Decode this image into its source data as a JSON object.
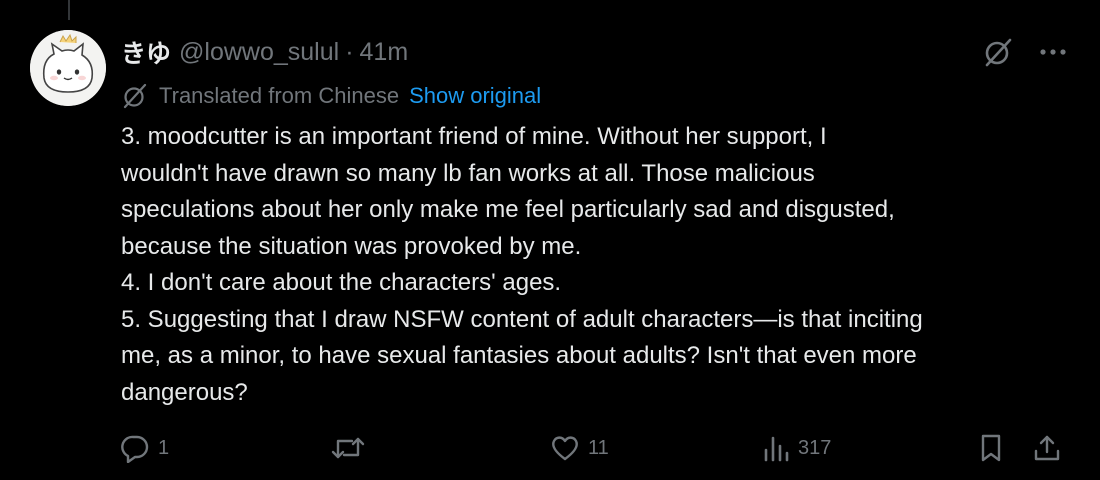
{
  "tweet": {
    "display_name": "きゆ",
    "handle": "@lowwo_sulul",
    "separator": "·",
    "time": "41m",
    "translated_label": "Translated from Chinese",
    "show_original_label": "Show original",
    "text_lines": [
      "3. moodcutter is an important friend of mine. Without her support, I",
      "wouldn't have drawn so many lb fan works at all. Those malicious",
      "speculations about her only make me feel particularly sad and disgusted,",
      "because the situation was provoked by me.",
      "4. I don't care about the characters' ages.",
      "5. Suggesting that I draw NSFW content of adult characters—is that inciting",
      "me, as a minor, to have sexual fantasies about adults? Isn't that even more",
      "dangerous?"
    ]
  },
  "actions": {
    "reply_count": "1",
    "retweet_count": "",
    "like_count": "11",
    "view_count": "317"
  },
  "icons": {
    "grok": "grok-icon",
    "more": "more-icon",
    "translate": "translate-icon",
    "reply": "reply-icon",
    "retweet": "retweet-icon",
    "like": "heart-icon",
    "views": "views-icon",
    "bookmark": "bookmark-icon",
    "share": "share-icon"
  },
  "colors": {
    "background": "#000000",
    "text_primary": "#e7e9ea",
    "text_secondary": "#71767b",
    "link": "#1d9bf0"
  }
}
